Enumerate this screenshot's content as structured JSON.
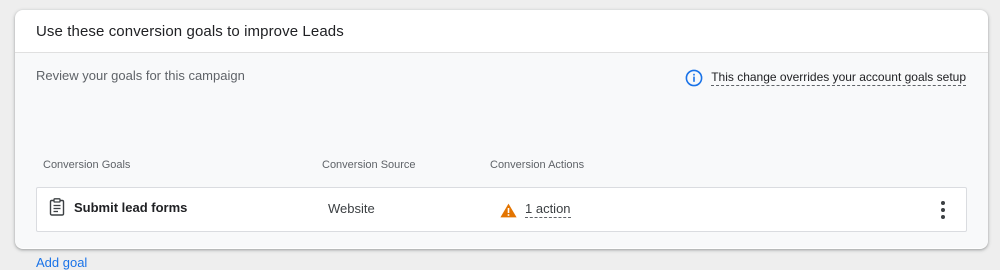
{
  "card": {
    "title": "Use these conversion goals to improve Leads",
    "subtitle": "Review your goals for this campaign",
    "override_link": "This change overrides your account goals setup"
  },
  "table": {
    "headers": {
      "goals": "Conversion Goals",
      "source": "Conversion Source",
      "actions": "Conversion Actions"
    },
    "rows": [
      {
        "goal": "Submit lead forms",
        "source": "Website",
        "actions": "1 action",
        "goal_icon": "clipboard-icon",
        "actions_icon": "warning-icon"
      }
    ]
  },
  "add_goal_label": "Add goal",
  "colors": {
    "accent": "#1a73e8",
    "warning": "#e37400",
    "text": "#202124",
    "muted": "#5f6368"
  }
}
